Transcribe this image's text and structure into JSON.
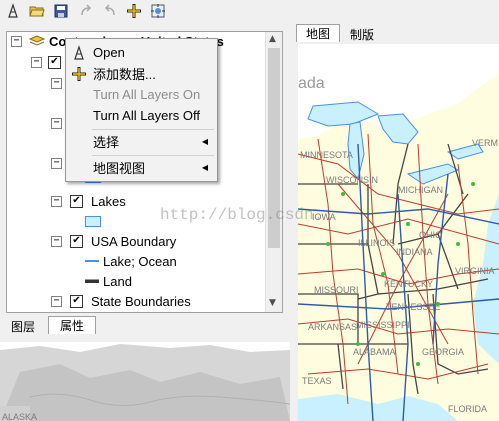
{
  "toolbar": {
    "icons": [
      "identify-icon",
      "open-folder-icon",
      "save-icon",
      "redo-icon",
      "undo-icon",
      "add-data-icon",
      "full-extent-icon"
    ]
  },
  "toc": {
    "root_label": "Conterminous United States",
    "layers": [
      {
        "label": "Lakes",
        "checked": true
      },
      {
        "label": "USA Boundary",
        "checked": true,
        "legend": [
          "Lake; Ocean",
          "Land"
        ]
      },
      {
        "label": "State Boundaries",
        "checked": true
      }
    ]
  },
  "context_menu": {
    "items": [
      {
        "label": "Open",
        "enabled": true,
        "icon": "identify-icon"
      },
      {
        "label": "添加数据...",
        "enabled": true,
        "icon": "add-data-icon"
      },
      {
        "label": "Turn All Layers On",
        "enabled": false
      },
      {
        "label": "Turn All Layers Off",
        "enabled": true
      },
      {
        "label": "选择",
        "enabled": true,
        "submenu": true
      },
      {
        "label": "地图视图",
        "enabled": true,
        "submenu": true
      }
    ]
  },
  "left_tabs": {
    "layers": "图层",
    "properties": "属性"
  },
  "map_tabs": {
    "map": "地图",
    "layout": "制版"
  },
  "map_labels": [
    "ada",
    "MINNESOTA",
    "WISCONSIN",
    "MICHIGAN",
    "IOWA",
    "OHIO",
    "ILLINOIS",
    "INDIANA",
    "MISSOURI",
    "KENTUCKY",
    "VIRGINIA",
    "TENNESSEE",
    "ARKANSAS",
    "MISSISSIPPI",
    "ALABAMA",
    "GEORGIA",
    "TEXAS",
    "FLORIDA",
    "VERM"
  ],
  "overview_label": "ALASKA",
  "watermark": "http://blog.csdn.",
  "colors": {
    "water": "#c8f0ff",
    "land": "#fffde0",
    "highway": "#c0392b",
    "interstate": "#2e5aa8"
  }
}
